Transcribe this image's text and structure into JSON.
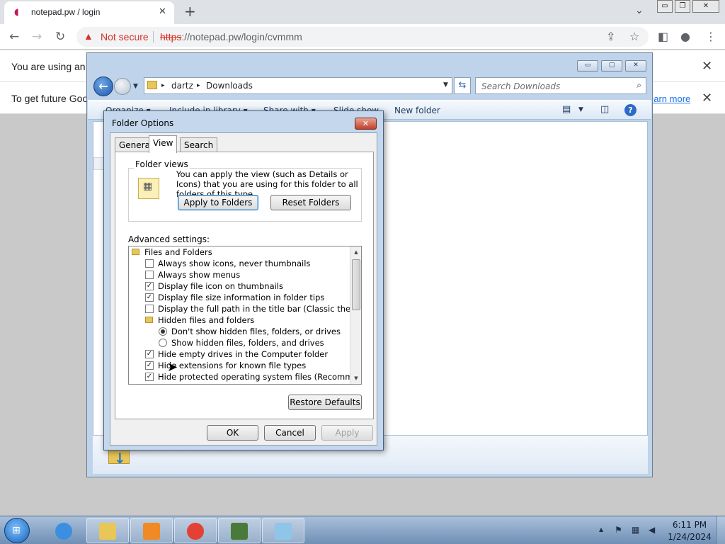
{
  "browser": {
    "tab_title": "notepad.pw / login",
    "tab_close": "✕",
    "new_tab": "+",
    "tab_menu": "⌄",
    "window_controls": [
      "▭",
      "❐",
      "✕"
    ],
    "not_secure": "Not secure",
    "url_scheme": "https",
    "url_rest": "://notepad.pw/login/cvmmm",
    "icons": {
      "back": "←",
      "forward": "→",
      "reload": "↻",
      "warning": "▲",
      "share": "⇪",
      "bookmark": "☆",
      "sidepanel": "◧",
      "profile": "●",
      "menu": "⋮"
    },
    "info_bar_1": "You are using an u",
    "info_bar_2": "To get future Goog",
    "learn_more": "earn more",
    "info_close": "✕"
  },
  "explorer": {
    "title_controls": [
      "▭",
      "▢",
      "✕"
    ],
    "breadcrumb": [
      "dartz",
      "Downloads"
    ],
    "crumb_sep": "▸",
    "search_placeholder": "Search Downloads",
    "commands": {
      "organize": "Organize ▾",
      "include_in_library": "Include in library ▾",
      "share_with": "Share with ▾",
      "slide_show": "Slide show",
      "new_folder": "New folder"
    },
    "help": "?"
  },
  "dialog": {
    "title": "Folder Options",
    "close": "✕",
    "tabs": [
      "General",
      "View",
      "Search"
    ],
    "active_tab": "View",
    "folder_views_label": "Folder views",
    "folder_views_text": "You can apply the view (such as Details or Icons) that you are using for this folder to all folders of this type.",
    "apply_to_folders": "Apply to Folders",
    "reset_folders": "Reset Folders",
    "advanced_label": "Advanced settings:",
    "tree": [
      {
        "kind": "folder",
        "indent": 0,
        "label": "Files and Folders"
      },
      {
        "kind": "check",
        "indent": 1,
        "checked": false,
        "label": "Always show icons, never thumbnails"
      },
      {
        "kind": "check",
        "indent": 1,
        "checked": false,
        "label": "Always show menus"
      },
      {
        "kind": "check",
        "indent": 1,
        "checked": true,
        "label": "Display file icon on thumbnails"
      },
      {
        "kind": "check",
        "indent": 1,
        "checked": true,
        "label": "Display file size information in folder tips"
      },
      {
        "kind": "check",
        "indent": 1,
        "checked": false,
        "label": "Display the full path in the title bar (Classic theme only)"
      },
      {
        "kind": "folder",
        "indent": 1,
        "label": "Hidden files and folders"
      },
      {
        "kind": "radio",
        "indent": 2,
        "checked": true,
        "label": "Don't show hidden files, folders, or drives"
      },
      {
        "kind": "radio",
        "indent": 2,
        "checked": false,
        "label": "Show hidden files, folders, and drives"
      },
      {
        "kind": "check",
        "indent": 1,
        "checked": true,
        "label": "Hide empty drives in the Computer folder"
      },
      {
        "kind": "check",
        "indent": 1,
        "checked": true,
        "label": "Hide extensions for known file types"
      },
      {
        "kind": "check",
        "indent": 1,
        "checked": true,
        "label": "Hide protected operating system files (Recommended)"
      }
    ],
    "check_mark": "✓",
    "scroll_up": "▲",
    "scroll_down": "▼",
    "restore_defaults": "Restore Defaults",
    "ok": "OK",
    "cancel": "Cancel",
    "apply": "Apply"
  },
  "taskbar": {
    "start_flag": "⊞",
    "apps": [
      {
        "name": "internet-explorer",
        "color": "#3c8fe0"
      },
      {
        "name": "file-explorer",
        "color": "#e8c657"
      },
      {
        "name": "media-player",
        "color": "#f08a24"
      },
      {
        "name": "google-chrome",
        "color": "#e34133"
      },
      {
        "name": "task-manager",
        "color": "#4a7a3a"
      },
      {
        "name": "notepad",
        "color": "#8fc5e8"
      }
    ],
    "tray_icons": [
      "▲",
      "⚑",
      "▦",
      "◀"
    ],
    "time": "6:11 PM",
    "date": "1/24/2024"
  },
  "cursor": "➤"
}
